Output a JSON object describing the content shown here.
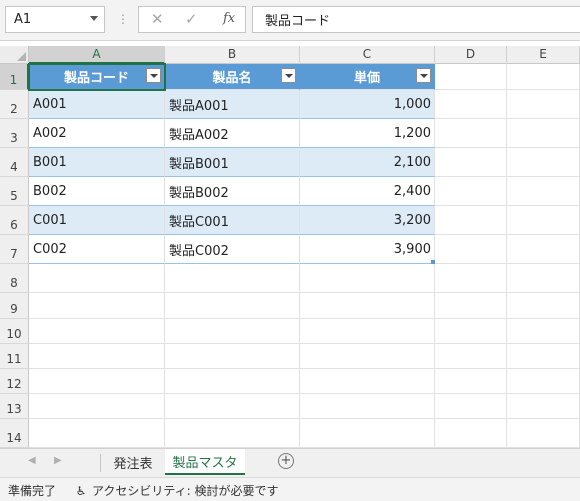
{
  "formula_bar": {
    "name_box": "A1",
    "cancel_icon": "✕",
    "enter_icon": "✓",
    "fx_label": "fx",
    "content": "製品コード"
  },
  "columns": [
    "A",
    "B",
    "C",
    "D",
    "E"
  ],
  "rows": [
    "1",
    "2",
    "3",
    "4",
    "5",
    "6",
    "7",
    "8",
    "9",
    "10",
    "11",
    "12",
    "13",
    "14"
  ],
  "table": {
    "headers": [
      "製品コード",
      "製品名",
      "単価"
    ],
    "data": [
      [
        "A001",
        "製品A001",
        "1,000"
      ],
      [
        "A002",
        "製品A002",
        "1,200"
      ],
      [
        "B001",
        "製品B001",
        "2,100"
      ],
      [
        "B002",
        "製品B002",
        "2,400"
      ],
      [
        "C001",
        "製品C001",
        "3,200"
      ],
      [
        "C002",
        "製品C002",
        "3,900"
      ]
    ]
  },
  "sheet_tabs": {
    "tabs": [
      "発注表",
      "製品マスタ"
    ],
    "active": "製品マスタ",
    "add_icon": "+"
  },
  "status_bar": {
    "ready": "準備完了",
    "accessibility": "アクセシビリティ: 検討が必要です"
  },
  "colors": {
    "table_header": "#5b9bd5",
    "band": "#ddebf7",
    "excel_green": "#217346"
  }
}
